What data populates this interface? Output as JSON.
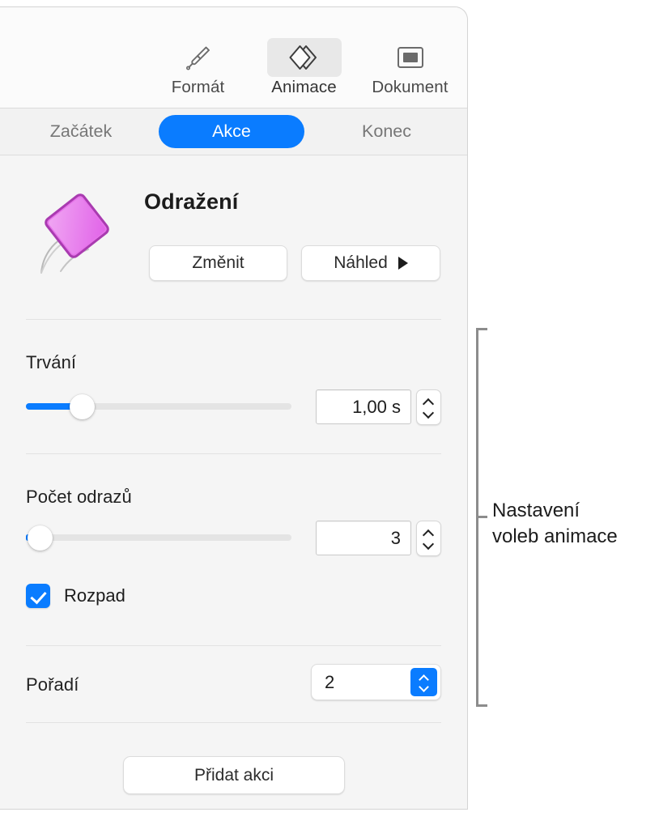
{
  "inspector": {
    "top_tabs": [
      {
        "label": "Formát",
        "icon": "paintbrush-icon",
        "selected": false
      },
      {
        "label": "Animace",
        "icon": "animate-diamonds-icon",
        "selected": true
      },
      {
        "label": "Dokument",
        "icon": "document-icon",
        "selected": false
      }
    ],
    "segment_tabs": [
      {
        "label": "Začátek",
        "active": false
      },
      {
        "label": "Akce",
        "active": true
      },
      {
        "label": "Konec",
        "active": false
      }
    ],
    "effect": {
      "name": "Odražení",
      "icon": "bouncing-square-icon",
      "change_button": "Změnit",
      "preview_button": "Náhled",
      "preview_icon": "play-triangle-icon"
    },
    "duration": {
      "label": "Trvání",
      "value": "1,00 s",
      "slider_percent": 21,
      "stepper_up_icon": "chevron-up-icon",
      "stepper_down_icon": "chevron-down-icon"
    },
    "bounces": {
      "label": "Počet odrazů",
      "value": "3",
      "slider_percent": 1,
      "stepper_up_icon": "chevron-up-icon",
      "stepper_down_icon": "chevron-down-icon"
    },
    "decay": {
      "label": "Rozpad",
      "checked": true,
      "check_icon": "checkmark-icon"
    },
    "order": {
      "label": "Pořadí",
      "value": "2",
      "popup_icon": "up-down-chevrons-icon"
    },
    "add_action_button": "Přidat akci"
  },
  "callout": {
    "text": "Nastavení voleb animace",
    "line1": "Nastavení",
    "line2": "voleb animace"
  },
  "colors": {
    "accent_blue": "#0a7cff",
    "panel_bg": "#f5f5f5",
    "topbar_bg": "#fbfbfb",
    "tabrow_bg": "#f2f2f2",
    "shape_magenta": "#e36ae8",
    "callout_gray": "#8c8c8c"
  }
}
